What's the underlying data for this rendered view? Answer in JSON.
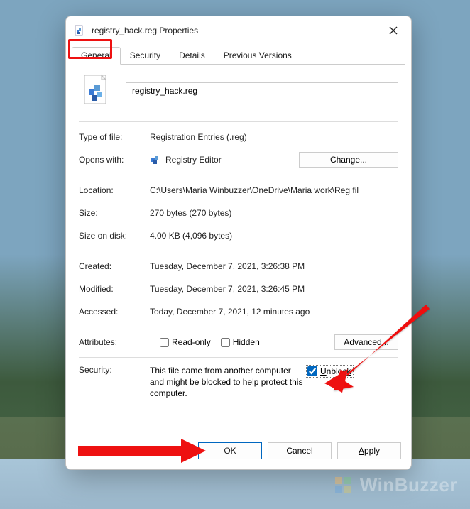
{
  "window": {
    "title": "registry_hack.reg Properties"
  },
  "tabs": {
    "general": "General",
    "security": "Security",
    "details": "Details",
    "previous": "Previous Versions"
  },
  "file": {
    "filename": "registry_hack.reg"
  },
  "fields": {
    "type_label": "Type of file:",
    "type_value": "Registration Entries (.reg)",
    "opens_label": "Opens with:",
    "opens_value": "Registry Editor",
    "change_btn": "Change...",
    "location_label": "Location:",
    "location_value": "C:\\Users\\María Winbuzzer\\OneDrive\\Maria work\\Reg fil",
    "size_label": "Size:",
    "size_value": "270 bytes (270 bytes)",
    "sizedisk_label": "Size on disk:",
    "sizedisk_value": "4.00 KB (4,096 bytes)",
    "created_label": "Created:",
    "created_value": "Tuesday, December 7, 2021, 3:26:38 PM",
    "modified_label": "Modified:",
    "modified_value": "Tuesday, December 7, 2021, 3:26:45 PM",
    "accessed_label": "Accessed:",
    "accessed_value": "Today, December 7, 2021, 12 minutes ago",
    "attributes_label": "Attributes:",
    "readonly_label": "Read-only",
    "hidden_label": "Hidden",
    "advanced_btn": "Advanced...",
    "security_label": "Security:",
    "security_text": "This file came from another computer and might be blocked to help protect this computer.",
    "unblock_label": "Unblock"
  },
  "buttons": {
    "ok": "OK",
    "cancel": "Cancel",
    "apply": "Apply"
  },
  "watermark": "WinBuzzer"
}
